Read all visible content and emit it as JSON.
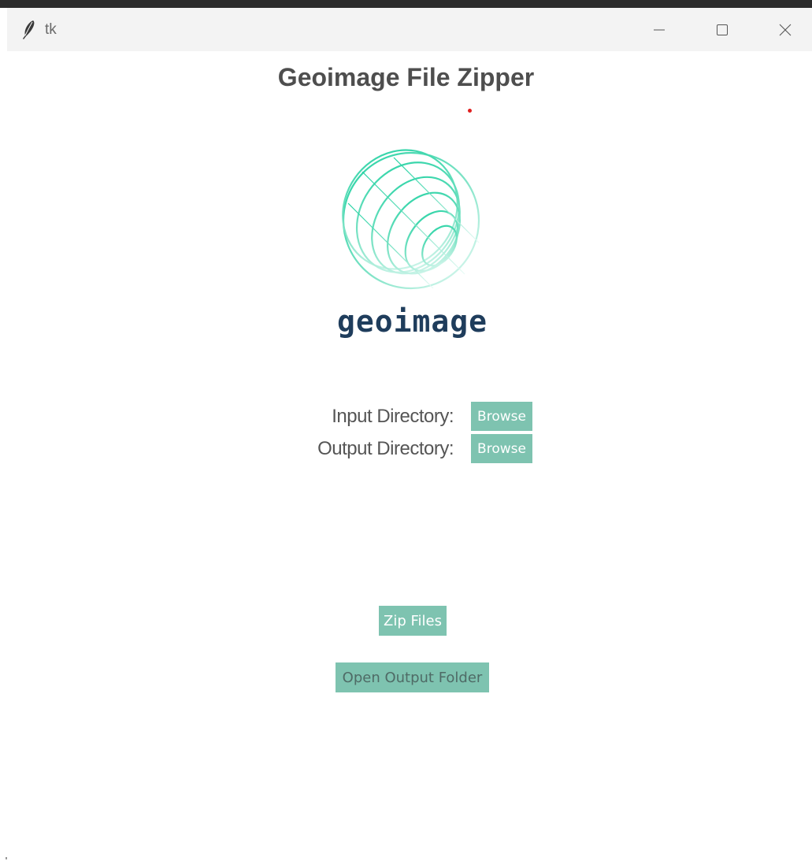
{
  "window": {
    "title": "tk",
    "controls": {
      "minimize": "minimize-icon",
      "maximize": "maximize-icon",
      "close": "close-icon"
    }
  },
  "app": {
    "title": "Geoimage File Zipper",
    "logo_text": "geoimage",
    "logo_colors": {
      "globe_start": "#1fd1a1",
      "globe_mid": "#7fe3c6",
      "globe_end": "#e9fbf6",
      "wordmark": "#1f3d5c"
    }
  },
  "form": {
    "input_label": "Input Directory:",
    "output_label": "Output Directory:",
    "browse_input": "Browse",
    "browse_output": "Browse"
  },
  "actions": {
    "zip_label": "Zip Files",
    "open_folder_label": "Open Output Folder"
  },
  "colors": {
    "button_bg": "#7ec3b0",
    "title_color": "#4e4e4e"
  }
}
